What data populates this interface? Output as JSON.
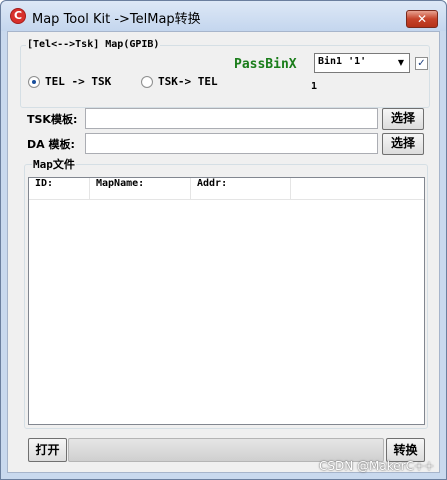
{
  "window": {
    "title": "Map Tool Kit ->TelMap转换",
    "app_icon_glyph": "C",
    "close_glyph": "✕"
  },
  "group_main": {
    "title": "[Tel<-->Tsk] Map(GPIB)",
    "radio_tel_tsk": "TEL -> TSK",
    "radio_tsk_tel": "TSK-> TEL",
    "selected_radio": "TEL -> TSK",
    "passbin_label": "PassBinX",
    "bin_select_value": "Bin1  '1'",
    "bin_count": "1",
    "checkbox_checked": true,
    "checkbox_glyph": "✓"
  },
  "tsk_template": {
    "label": "TSK模板:",
    "value": "",
    "button": "选择"
  },
  "da_template": {
    "label": "DA 模板:",
    "value": "",
    "button": "选择"
  },
  "map_files": {
    "title": "Map文件",
    "columns": [
      "ID:",
      "MapName:",
      "Addr:"
    ],
    "rows": []
  },
  "footer": {
    "open_button": "打开",
    "convert_button": "转换",
    "progress_fraction": 0
  },
  "watermark": "CSDN @MakerC++",
  "colors": {
    "passbin": "#1a7d1a",
    "close_button": "#c6432a",
    "title_bar": "#c4d6ee"
  }
}
